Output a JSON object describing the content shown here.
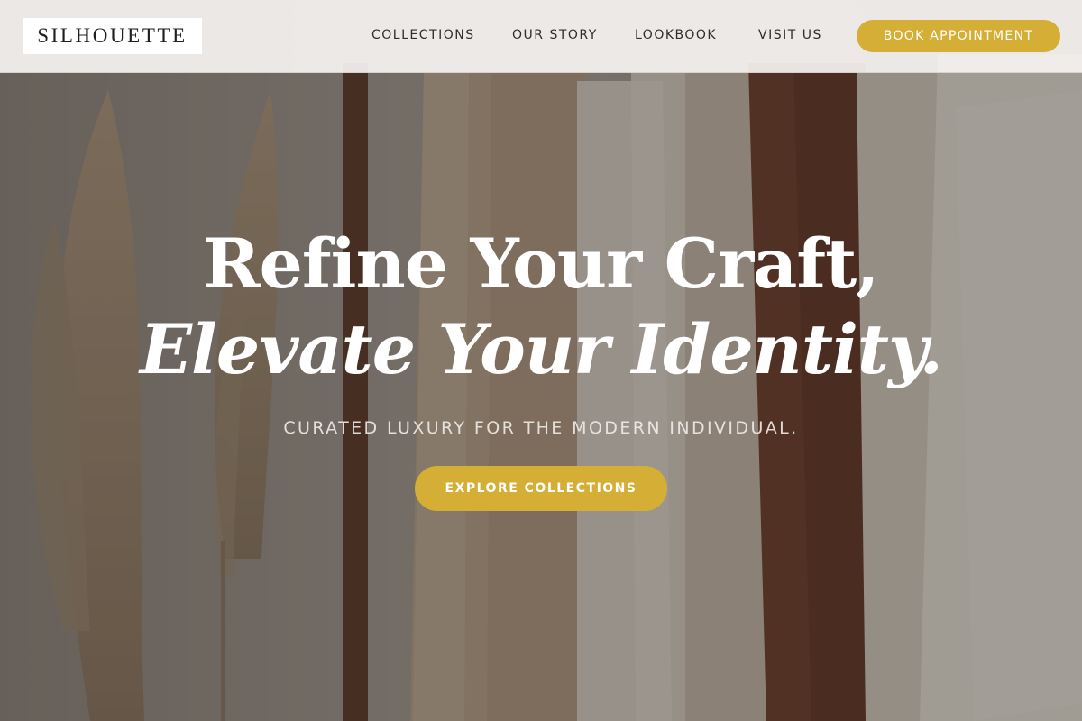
{
  "brand": {
    "logo_text": "SILHOUETTE"
  },
  "nav": {
    "items": [
      {
        "label": "COLLECTIONS"
      },
      {
        "label": "OUR STORY"
      },
      {
        "label": "LOOKBOOK"
      },
      {
        "label": "VISIT US"
      }
    ],
    "cta_label": "BOOK APPOINTMENT"
  },
  "hero": {
    "headline_line1": "Refine Your Craft,",
    "headline_line2": "Elevate Your Identity.",
    "tagline": "CURATED LUXURY FOR THE MODERN INDIVIDUAL.",
    "cta_label": "EXPLORE COLLECTIONS"
  },
  "colors": {
    "accent": "#d4ae35",
    "header_bg": "#f5f3f1",
    "text_dark": "#2e2e2e",
    "hero_text": "#ffffff"
  }
}
